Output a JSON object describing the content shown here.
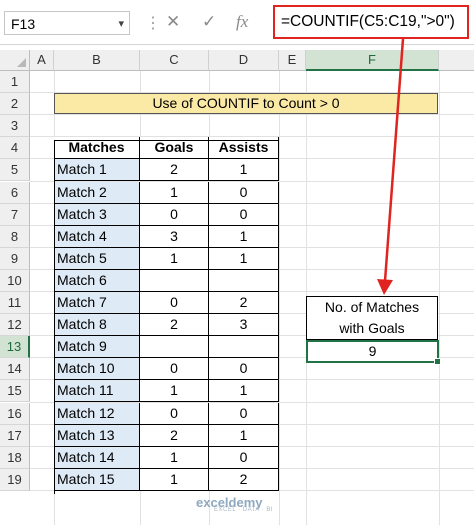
{
  "formula_bar": {
    "name_box": "F13",
    "cancel_icon": "✕",
    "enter_icon": "✓",
    "fx_icon": "fx",
    "formula": "=COUNTIF(C5:C19,\">0\")"
  },
  "columns": [
    "A",
    "B",
    "C",
    "D",
    "E",
    "F"
  ],
  "rows": [
    "1",
    "2",
    "3",
    "4",
    "5",
    "6",
    "7",
    "8",
    "9",
    "10",
    "11",
    "12",
    "13",
    "14",
    "15",
    "16",
    "17",
    "18",
    "19"
  ],
  "title": "Use of COUNTIF to Count > 0",
  "table": {
    "headers": [
      "Matches",
      "Goals",
      "Assists"
    ],
    "rows": [
      [
        "Match 1",
        "2",
        "1"
      ],
      [
        "Match 2",
        "1",
        "0"
      ],
      [
        "Match 3",
        "0",
        "0"
      ],
      [
        "Match 4",
        "3",
        "1"
      ],
      [
        "Match 5",
        "1",
        "1"
      ],
      [
        "Match 6",
        "",
        ""
      ],
      [
        "Match 7",
        "0",
        "2"
      ],
      [
        "Match 8",
        "2",
        "3"
      ],
      [
        "Match 9",
        "",
        ""
      ],
      [
        "Match 10",
        "0",
        "0"
      ],
      [
        "Match 11",
        "1",
        "1"
      ],
      [
        "Match 12",
        "0",
        "0"
      ],
      [
        "Match 13",
        "2",
        "1"
      ],
      [
        "Match 14",
        "1",
        "0"
      ],
      [
        "Match 15",
        "1",
        "2"
      ]
    ]
  },
  "result": {
    "label_line1": "No. of Matches",
    "label_line2": "with Goals",
    "value": "9"
  },
  "watermark": {
    "name": "exceldemy",
    "tagline": "EXCEL · DATA · BI"
  },
  "colors": {
    "highlight_red": "#e0241f",
    "excel_green": "#217346",
    "title_fill": "#fbe9a6",
    "name_fill": "#deeaf6"
  }
}
